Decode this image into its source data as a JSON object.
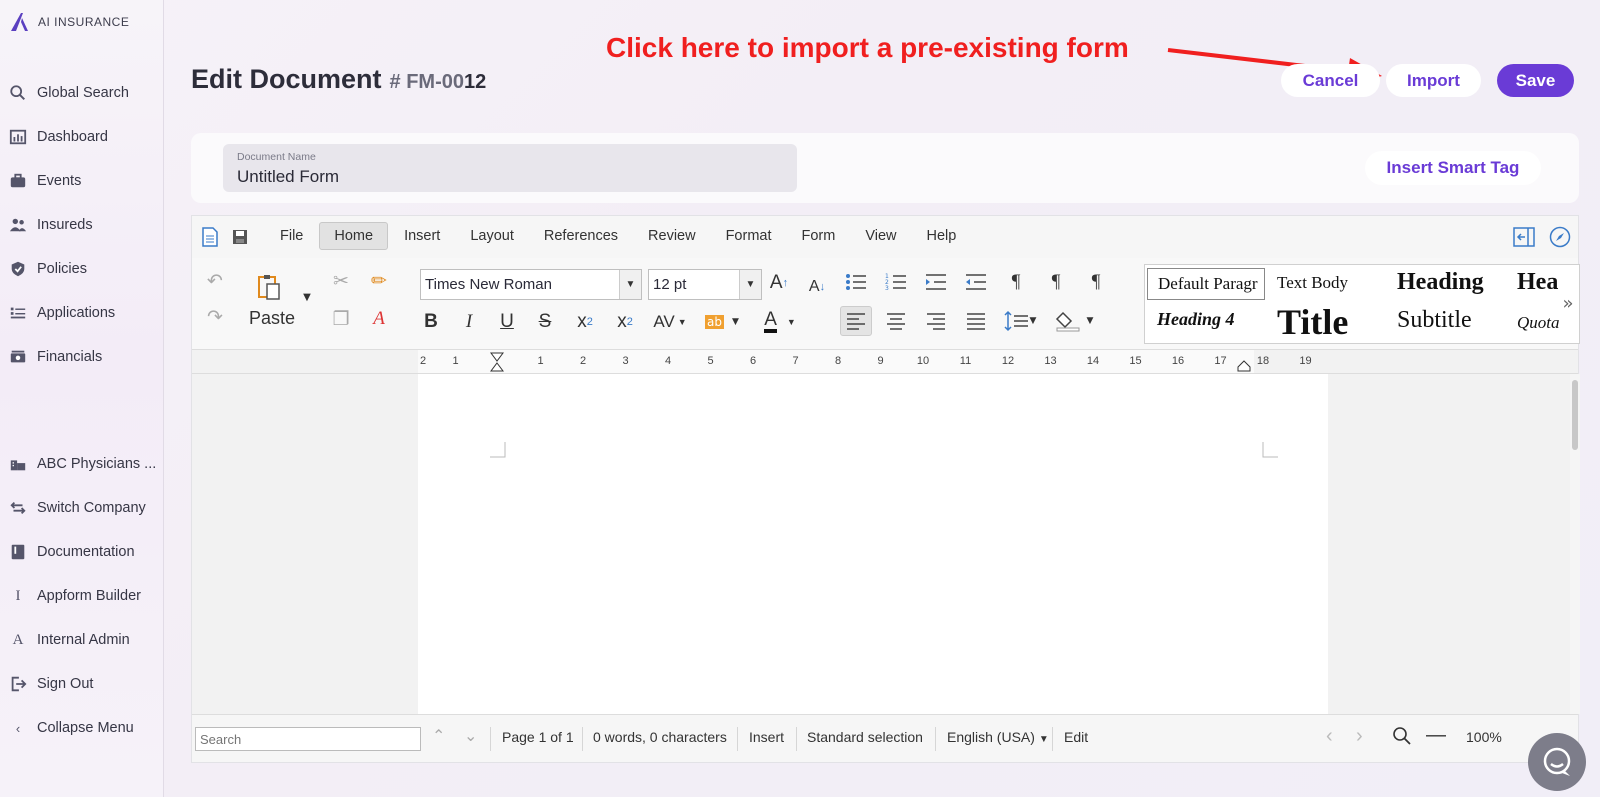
{
  "brand": {
    "name": "AI INSURANCE",
    "color": "#5a3fc0"
  },
  "sidebar": {
    "items": [
      {
        "label": "Global Search",
        "icon": "search-icon"
      },
      {
        "label": "Dashboard",
        "icon": "chart-icon"
      },
      {
        "label": "Events",
        "icon": "briefcase-icon"
      },
      {
        "label": "Insureds",
        "icon": "people-icon"
      },
      {
        "label": "Policies",
        "icon": "shield-icon"
      },
      {
        "label": "Applications",
        "icon": "list-icon"
      },
      {
        "label": "Financials",
        "icon": "money-icon"
      }
    ],
    "bottom_items": [
      {
        "label": "ABC Physicians ...",
        "icon": "building-icon"
      },
      {
        "label": "Switch Company",
        "icon": "switch-icon"
      },
      {
        "label": "Documentation",
        "icon": "book-icon"
      },
      {
        "label": "Appform Builder",
        "icon": "letter-i-icon"
      },
      {
        "label": "Internal Admin",
        "icon": "letter-a-icon"
      },
      {
        "label": "Sign Out",
        "icon": "sign-out-icon"
      },
      {
        "label": "Collapse Menu",
        "icon": "chevron-left-icon"
      }
    ]
  },
  "header": {
    "title": "Edit Document",
    "doc_id_prefix": "# FM-00",
    "doc_id_suffix": "12",
    "annotation": "Click here to import a pre-existing form",
    "cancel_label": "Cancel",
    "import_label": "Import",
    "save_label": "Save",
    "accent_color": "#6a3bd6",
    "annotation_color": "#f01f1f"
  },
  "document_name": {
    "label": "Document Name",
    "value": "Untitled Form",
    "smart_tag_label": "Insert Smart Tag"
  },
  "editor": {
    "menu": [
      "File",
      "Home",
      "Insert",
      "Layout",
      "References",
      "Review",
      "Format",
      "Form",
      "View",
      "Help"
    ],
    "active_menu": "Home",
    "paste_label": "Paste",
    "font_family": "Times New Roman",
    "font_size": "12 pt",
    "styles": [
      "Default Paragr",
      "Text Body",
      "Heading",
      "Hea",
      "Heading 4",
      "Title",
      "Subtitle",
      "Quota"
    ],
    "ruler_ticks": [
      "2",
      "1",
      "1",
      "2",
      "3",
      "4",
      "5",
      "6",
      "7",
      "8",
      "9",
      "10",
      "11",
      "12",
      "13",
      "14",
      "15",
      "16",
      "17",
      "18",
      "19"
    ]
  },
  "statusbar": {
    "search_placeholder": "Search",
    "page": "Page 1 of 1",
    "counts": "0 words, 0 characters",
    "mode": "Insert",
    "selection": "Standard selection",
    "language": "English (USA)",
    "edit": "Edit",
    "zoom": "100%"
  }
}
